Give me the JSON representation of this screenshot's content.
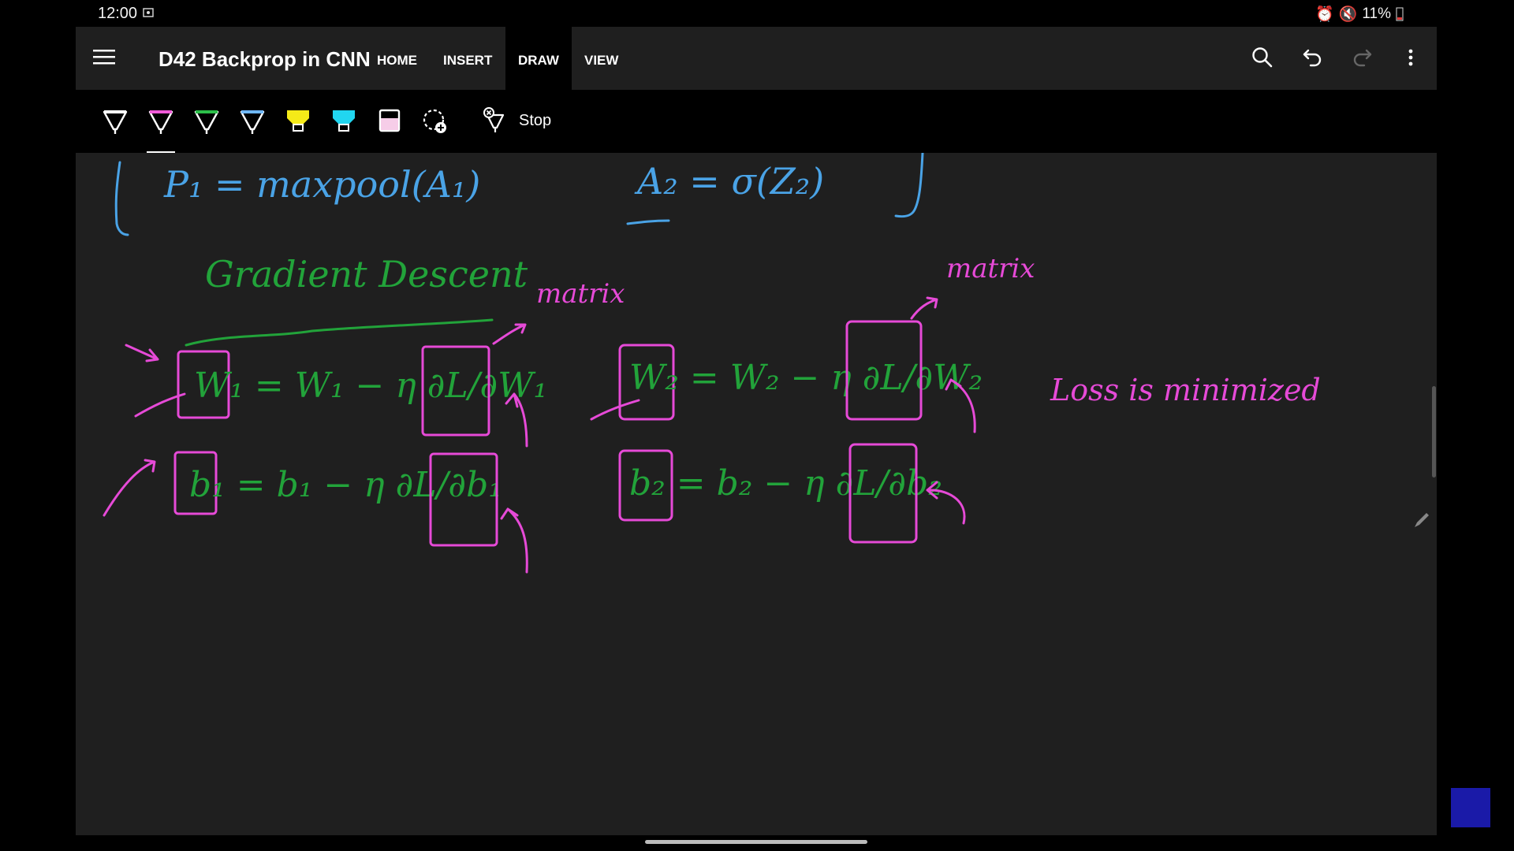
{
  "status_bar": {
    "time": "12:00",
    "battery": "11%"
  },
  "app": {
    "doc_title": "D42 Backprop in CNN",
    "tabs": [
      {
        "label": "HOME",
        "active": false
      },
      {
        "label": "INSERT",
        "active": false
      },
      {
        "label": "DRAW",
        "active": true
      },
      {
        "label": "VIEW",
        "active": false
      }
    ],
    "actions": [
      "search-icon",
      "undo-icon",
      "redo-icon",
      "more-icon"
    ]
  },
  "draw_toolbar": {
    "pens": [
      {
        "name": "pen-white",
        "color": "#ffffff"
      },
      {
        "name": "pen-pink",
        "color": "#f05ad8"
      },
      {
        "name": "pen-green",
        "color": "#2cbf4a"
      },
      {
        "name": "pen-blue",
        "color": "#6fb8ff"
      },
      {
        "name": "highlighter-yellow",
        "color": "#f5ea18"
      },
      {
        "name": "highlighter-cyan",
        "color": "#21d6f0"
      },
      {
        "name": "highlighter-pink",
        "color": "#f6cde8"
      }
    ],
    "selected_pen": "pen-pink",
    "stop_label": "Stop"
  },
  "canvas": {
    "top_line": {
      "p1": "P₁ = maxpool(A₁)",
      "a2": "A₂ = σ(Z₂)"
    },
    "heading": "Gradient Descent",
    "annotations": {
      "matrix_left": "matrix",
      "matrix_right": "matrix",
      "loss": "Loss is minimized"
    },
    "equations": {
      "w1": "W₁ = W₁ − η ∂L/∂W₁",
      "w2": "W₂ = W₂ − η ∂L/∂W₂",
      "b1": "b₁ = b₁ − η ∂L/∂b₁",
      "b2": "b₂ = b₂ − η ∂L/∂b₂"
    },
    "colors": {
      "green_ink": "#22a33a",
      "pink_ink": "#e64ad7",
      "blue_ink": "#4aa3e6",
      "background": "#1f1f1f"
    }
  }
}
